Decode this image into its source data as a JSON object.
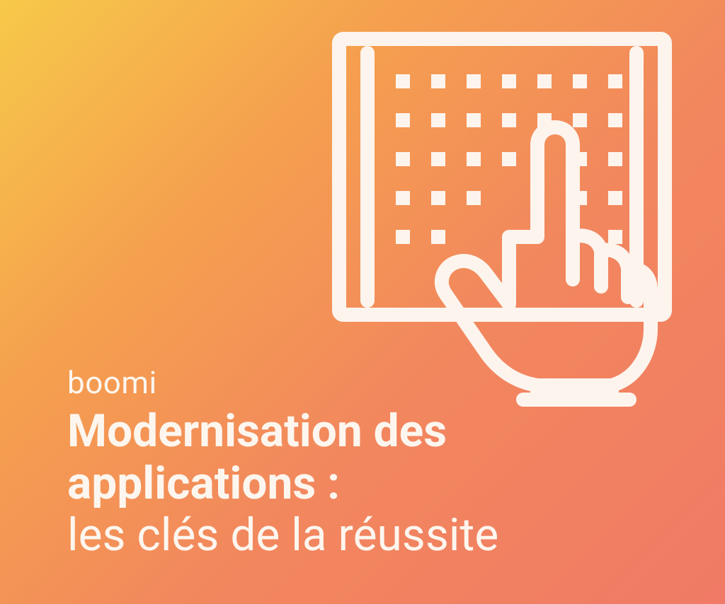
{
  "brand": "boomi",
  "title_bold_line1": "Modernisation des",
  "title_bold_line2": "applications :",
  "title_light": "les clés de la réussite",
  "icon_stroke": "#fdf4ed",
  "gradient_start": "#f7c94a",
  "gradient_end": "#f07a65"
}
